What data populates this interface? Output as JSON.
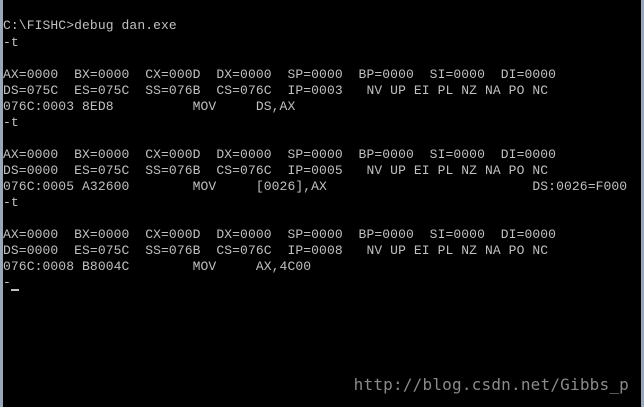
{
  "console": {
    "lines": [
      "C:\\FISHC>debug dan.exe",
      "-t",
      "",
      "AX=0000  BX=0000  CX=000D  DX=0000  SP=0000  BP=0000  SI=0000  DI=0000",
      "DS=075C  ES=075C  SS=076B  CS=076C  IP=0003   NV UP EI PL NZ NA PO NC",
      "076C:0003 8ED8          MOV     DS,AX",
      "-t",
      "",
      "AX=0000  BX=0000  CX=000D  DX=0000  SP=0000  BP=0000  SI=0000  DI=0000",
      "DS=0000  ES=075C  SS=076B  CS=076C  IP=0005   NV UP EI PL NZ NA PO NC",
      "076C:0005 A32600        MOV     [0026],AX                          DS:0026=F000",
      "-t",
      "",
      "AX=0000  BX=0000  CX=000D  DX=0000  SP=0000  BP=0000  SI=0000  DI=0000",
      "DS=0000  ES=075C  SS=076B  CS=076C  IP=0008   NV UP EI PL NZ NA PO NC",
      "076C:0008 B8004C        MOV     AX,4C00",
      "-"
    ],
    "watermark": "http://blog.csdn.net/Gibbs_p"
  },
  "colors": {
    "background": "#000000",
    "text": "#c0c0c0",
    "frame": "#9aa7b8",
    "watermark": "#8a8a8a"
  }
}
